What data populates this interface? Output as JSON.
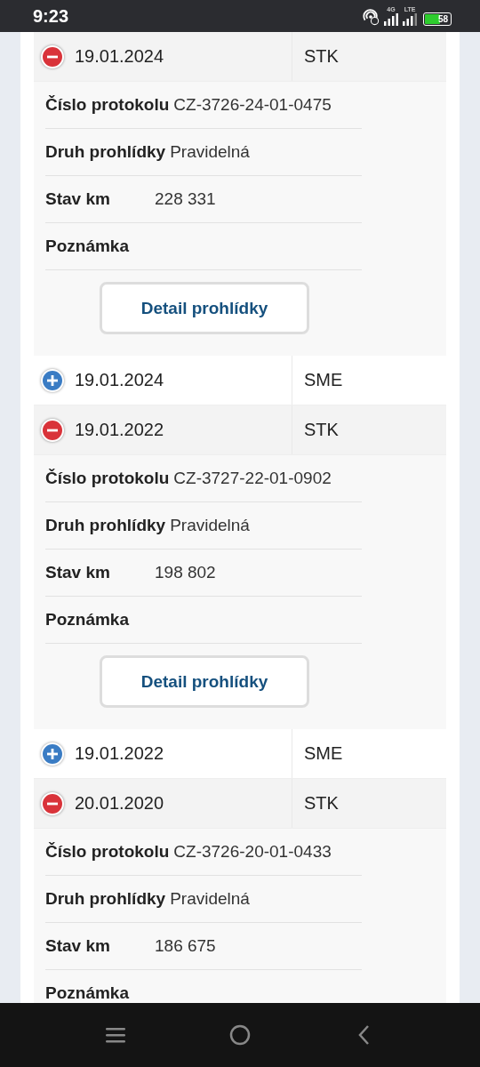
{
  "status_bar": {
    "time": "9:23",
    "network_1": "4G",
    "network_2": "LTE",
    "battery": "58"
  },
  "inspections": [
    {
      "date": "19.01.2024",
      "type": "STK",
      "expanded": true,
      "details": [
        {
          "label": "Číslo protokolu",
          "value": "CZ-3726-24-01-0475"
        },
        {
          "label": "Druh prohlídky",
          "value": "Pravidelná"
        },
        {
          "label": "Stav km",
          "value": "228 331"
        },
        {
          "label": "Poznámka"
        }
      ],
      "button": "Detail prohlídky"
    },
    {
      "date": "19.01.2024",
      "type": "SME",
      "expanded": false
    },
    {
      "date": "19.01.2022",
      "type": "STK",
      "expanded": true,
      "details": [
        {
          "label": "Číslo protokolu",
          "value": "CZ-3727-22-01-0902"
        },
        {
          "label": "Druh prohlídky",
          "value": "Pravidelná"
        },
        {
          "label": "Stav km",
          "value": "198 802"
        },
        {
          "label": "Poznámka"
        }
      ],
      "button": "Detail prohlídky"
    },
    {
      "date": "19.01.2022",
      "type": "SME",
      "expanded": false
    },
    {
      "date": "20.01.2020",
      "type": "STK",
      "expanded": true,
      "details": [
        {
          "label": "Číslo protokolu",
          "value": "CZ-3726-20-01-0433"
        },
        {
          "label": "Druh prohlídky",
          "value": "Pravidelná"
        },
        {
          "label": "Stav km",
          "value": "186 675"
        },
        {
          "label": "Poznámka"
        }
      ]
    }
  ]
}
